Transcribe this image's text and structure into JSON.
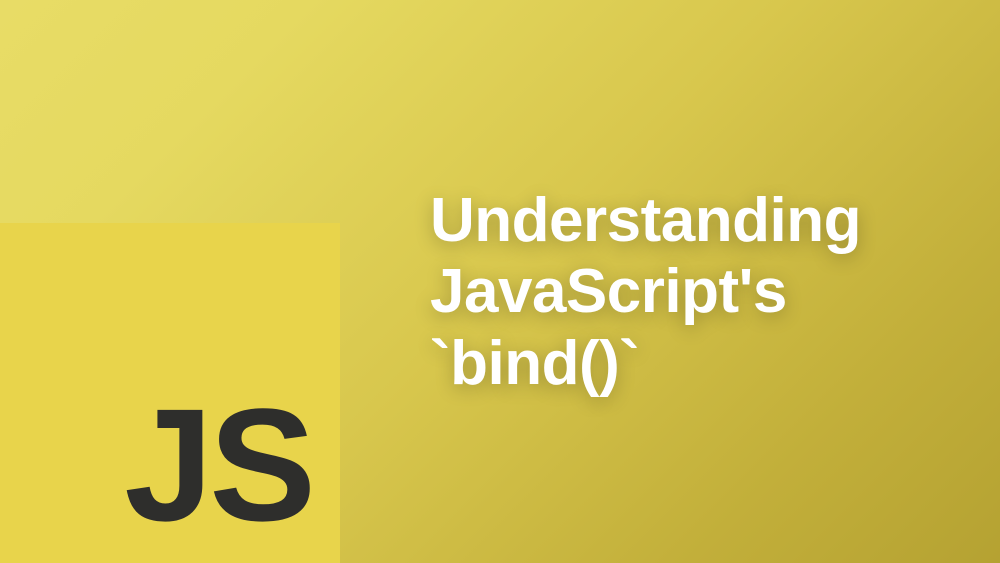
{
  "hero": {
    "logo_text": "JS",
    "title": "Understanding\nJavaScript's\n`bind()`"
  }
}
